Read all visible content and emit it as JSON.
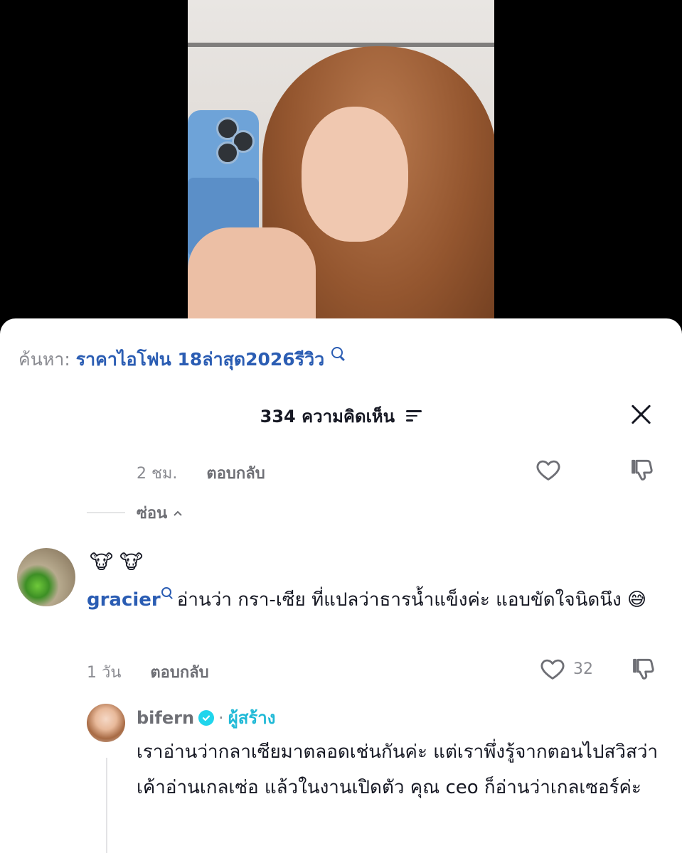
{
  "search": {
    "prefix": "ค้นหา:",
    "query": "ราคาไอโฟน 18ล่าสุด2026รีวิว"
  },
  "comments_header": {
    "title": "334 ความคิดเห็น"
  },
  "previous_reply_meta": {
    "time": "2 ชม.",
    "reply_label": "ตอบกลับ"
  },
  "hide_label": "ซ่อน",
  "comment": {
    "emoji_line": "🐮 🐮",
    "username": "gracier",
    "text": "อ่านว่า กรา-เซีย ที่แปลว่าธารน้ำแข็งค่ะ แอบขัดใจนิดนึง 😅",
    "time": "1 วัน",
    "reply_label": "ตอบกลับ",
    "likes": "32"
  },
  "creator_reply": {
    "username": "bifern",
    "separator": "·",
    "creator_label": "ผู้สร้าง",
    "text": "เราอ่านว่ากลาเซียมาตลอดเช่นกันค่ะ แต่เราพึ่งรู้จากตอนไปสวิสว่าเค้าอ่านเกลเซ่อ แล้วในงานเปิดตัว คุณ ceo ก็อ่านว่าเกลเซอร์ค่ะ"
  },
  "colors": {
    "link_blue": "#2b5db3",
    "creator_cyan": "#1fb9d6",
    "muted_gray": "#8a8b91"
  }
}
